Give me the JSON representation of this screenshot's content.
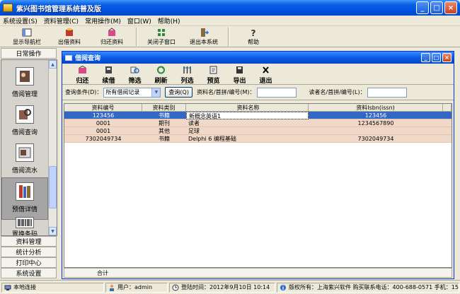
{
  "window": {
    "title": "紫兴图书馆管理系统普及版"
  },
  "menu": [
    "系统设置(S)",
    "资料管理(C)",
    "常用操作(M)",
    "窗口(W)",
    "帮助(H)"
  ],
  "toolbar": [
    {
      "label": "显示导航栏",
      "icon": "navigation-icon"
    },
    {
      "label": "出借资料",
      "icon": "lend-icon"
    },
    {
      "label": "归还资料",
      "icon": "return-icon"
    },
    {
      "label": "关闭子窗口",
      "icon": "close-child-icon"
    },
    {
      "label": "退出本系统",
      "icon": "exit-icon"
    },
    {
      "label": "帮助",
      "icon": "help-icon"
    }
  ],
  "sidebar": {
    "header": "日常操作",
    "items": [
      {
        "label": "借阅管理",
        "icon": "borrow-manage-icon"
      },
      {
        "label": "借阅查询",
        "icon": "borrow-query-icon"
      },
      {
        "label": "借阅流水",
        "icon": "borrow-log-icon"
      },
      {
        "label": "预借详情",
        "icon": "reserve-detail-icon"
      },
      {
        "label": "置换条码",
        "icon": "barcode-icon"
      }
    ],
    "categories": [
      "资料管理",
      "统计分析",
      "打印中心",
      "系统设置"
    ]
  },
  "child": {
    "title": "借阅查询",
    "toolbar": [
      {
        "label": "归还",
        "icon": "return-icon"
      },
      {
        "label": "续借",
        "icon": "renew-icon"
      },
      {
        "label": "筛选",
        "icon": "filter-icon"
      },
      {
        "label": "刷新",
        "icon": "refresh-icon"
      },
      {
        "label": "列选",
        "icon": "column-select-icon"
      },
      {
        "label": "预览",
        "icon": "preview-icon"
      },
      {
        "label": "导出",
        "icon": "export-icon"
      },
      {
        "label": "退出",
        "icon": "exit-icon"
      }
    ],
    "query": {
      "condition_label": "查询条件(D)：",
      "condition_value": "所有借阅记录",
      "query_button": "查询(Q)",
      "item_label": "资料名/首拼/编号(M)：",
      "item_value": "",
      "reader_label": "读者名/首拼/编号(L)：",
      "reader_value": ""
    },
    "columns": [
      "资料编号",
      "资料类别",
      "资料名称",
      "资料Isbn(issn)",
      ""
    ],
    "rows": [
      {
        "id": "123456",
        "type": "书籍",
        "name": "新概念英语1",
        "isbn": "123456",
        "selected": true
      },
      {
        "id": "0001",
        "type": "期刊",
        "name": "读者",
        "isbn": "1234567890",
        "selected": false
      },
      {
        "id": "0001",
        "type": "其他",
        "name": "足球",
        "isbn": "",
        "selected": false
      },
      {
        "id": "7302049734",
        "type": "书籍",
        "name": "Delphi 6 编程基础",
        "isbn": "7302049734",
        "selected": false
      }
    ],
    "footer": "合计"
  },
  "status": {
    "connection": "本地连接",
    "user": "用户：admin",
    "login_time": "登陆时间：2012年9月10日 10:14",
    "copyright": "版权所有：上海紫兴软件 购买联系电话：400-688-0571 手机：15"
  }
}
